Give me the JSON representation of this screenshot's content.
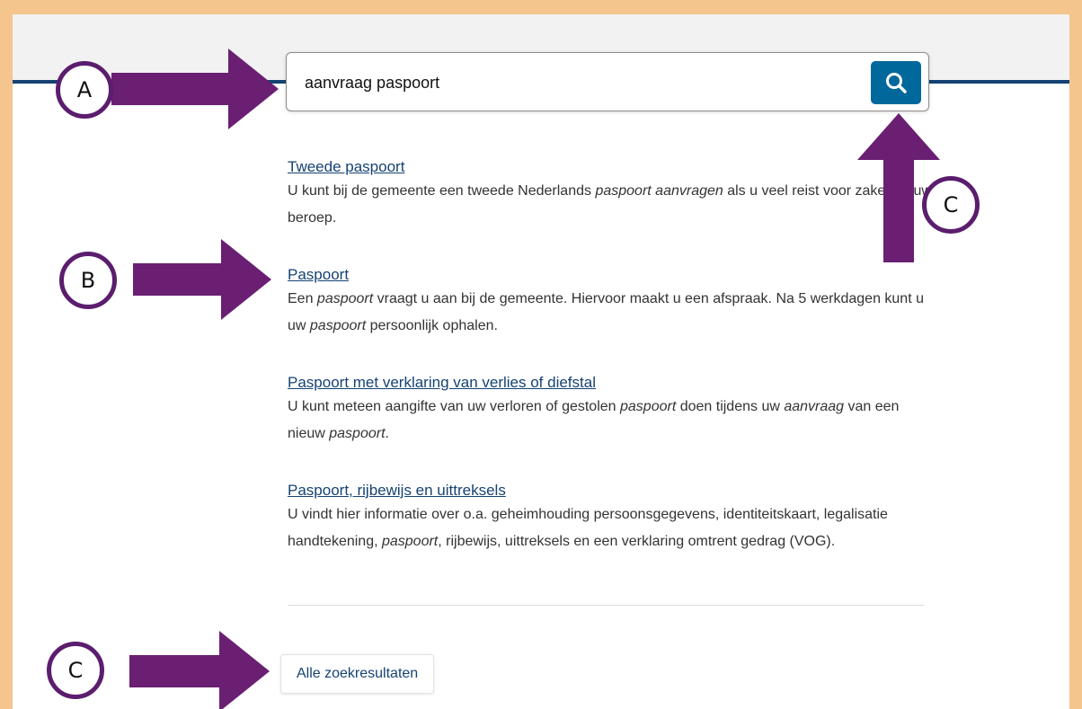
{
  "search": {
    "value": "aanvraag paspoort",
    "button_icon": "search-icon"
  },
  "results": [
    {
      "title": "Tweede paspoort",
      "description": [
        {
          "text": "U kunt bij de gemeente een tweede Nederlands "
        },
        {
          "text": "paspoort aanvragen",
          "italic": true
        },
        {
          "text": " als u veel reist voor zaken of uw beroep."
        }
      ]
    },
    {
      "title": "Paspoort",
      "description": [
        {
          "text": "Een "
        },
        {
          "text": "paspoort",
          "italic": true
        },
        {
          "text": " vraagt u aan bij de gemeente. Hiervoor maakt u een afspraak. Na 5 werkdagen kunt u uw "
        },
        {
          "text": "paspoort",
          "italic": true
        },
        {
          "text": " persoonlijk ophalen."
        }
      ]
    },
    {
      "title": "Paspoort met verklaring van verlies of diefstal",
      "description": [
        {
          "text": "U kunt meteen aangifte van uw verloren of gestolen "
        },
        {
          "text": "paspoort",
          "italic": true
        },
        {
          "text": " doen tijdens uw "
        },
        {
          "text": "aanvraag",
          "italic": true
        },
        {
          "text": " van een nieuw "
        },
        {
          "text": "paspoort",
          "italic": true
        },
        {
          "text": "."
        }
      ]
    },
    {
      "title": "Paspoort, rijbewijs en uittreksels",
      "description": [
        {
          "text": "U vindt hier informatie over o.a. geheimhouding persoonsgegevens, identiteitskaart, legalisatie handtekening, "
        },
        {
          "text": "paspoort",
          "italic": true
        },
        {
          "text": ", rijbewijs, uittreksels en een verklaring omtrent gedrag (VOG)."
        }
      ]
    }
  ],
  "all_results_label": "Alle zoekresultaten",
  "annotations": {
    "a": "A",
    "b": "B",
    "c_search": "C",
    "c_all": "C"
  },
  "colors": {
    "frame": "#f5c58e",
    "header_line": "#154273",
    "link": "#154273",
    "search_button": "#01689b",
    "annotation_arrow": "#6a1f73",
    "annotation_ring": "#5b1d6e"
  }
}
